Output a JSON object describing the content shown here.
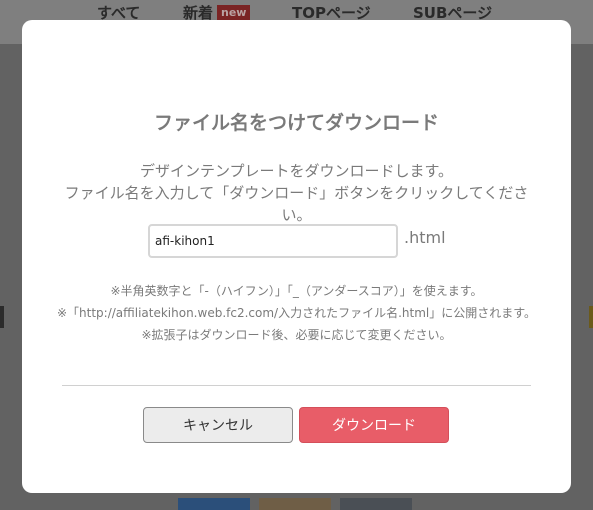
{
  "background": {
    "nav": [
      {
        "label": "すべて"
      },
      {
        "label": "新着",
        "badge": "new"
      },
      {
        "label": "TOPページ"
      },
      {
        "label": "SUBページ"
      }
    ]
  },
  "dialog": {
    "title": "ファイル名をつけてダウンロード",
    "description": [
      "デザインテンプレートをダウンロードします。",
      "ファイル名を入力して「ダウンロード」ボタンをクリックしてください。"
    ],
    "filename_value": "afi-kihon1",
    "extension": ".html",
    "notes": [
      "※半角英数字と「-（ハイフン）」「_（アンダースコア）」を使えます。",
      "※「http://affiliatekihon.web.fc2.com/入力されたファイル名.html」に公開されます。",
      "※拡張子はダウンロード後、必要に応じて変更ください。"
    ],
    "cancel_label": "キャンセル",
    "download_label": "ダウンロード"
  },
  "colors": {
    "overlay": "#5a5a5a",
    "download_button": "#e85d68",
    "text_muted": "#7a7a7a"
  }
}
